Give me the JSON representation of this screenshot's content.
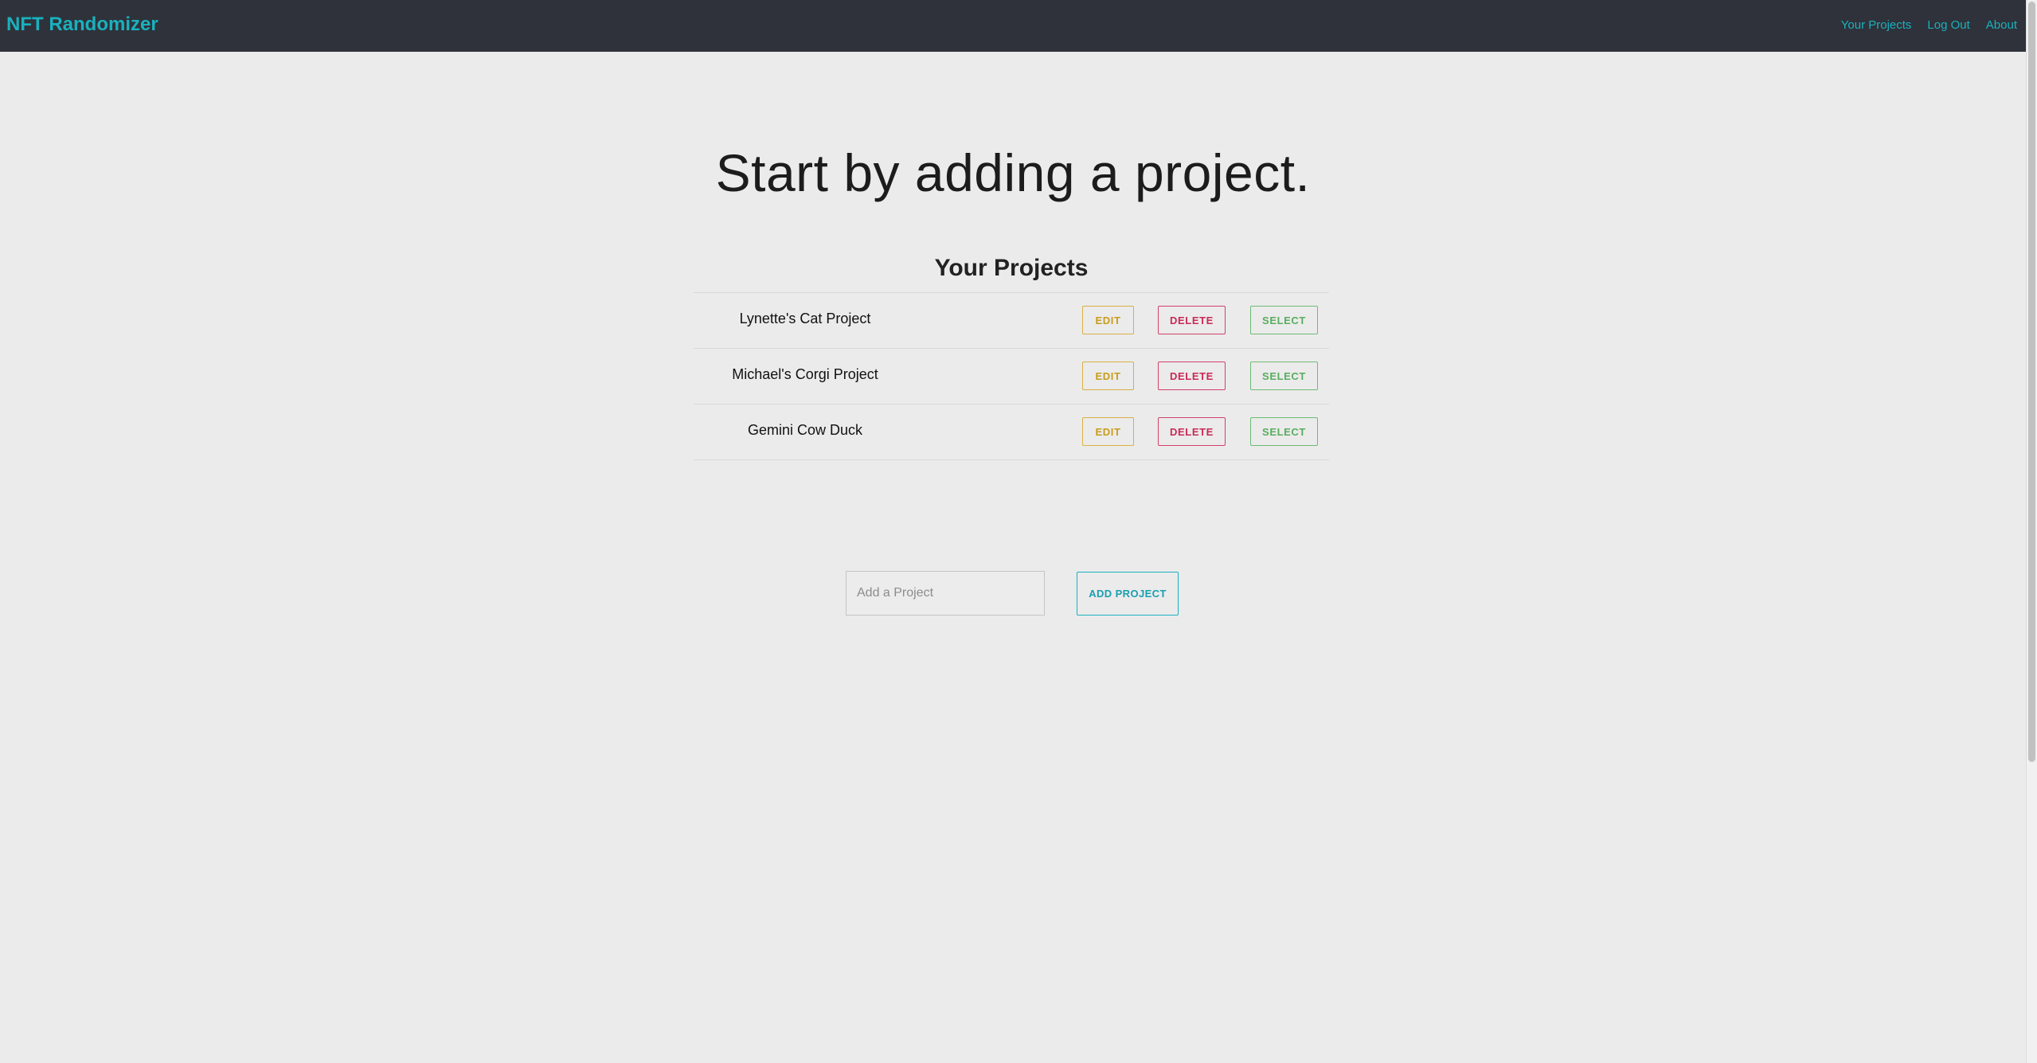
{
  "navbar": {
    "brand": "NFT Randomizer",
    "links": [
      "Your Projects",
      "Log Out",
      "About"
    ]
  },
  "hero": {
    "title": "Start by adding a project."
  },
  "projects": {
    "title": "Your Projects",
    "items": [
      {
        "name": "Lynette's Cat Project",
        "edit": "EDIT",
        "delete": "DELETE",
        "select": "SELECT"
      },
      {
        "name": "Michael's Corgi Project",
        "edit": "EDIT",
        "delete": "DELETE",
        "select": "SELECT"
      },
      {
        "name": "Gemini Cow Duck",
        "edit": "EDIT",
        "delete": "DELETE",
        "select": "SELECT"
      }
    ]
  },
  "add_form": {
    "placeholder": "Add a Project",
    "value": "",
    "button_label": "ADD PROJECT"
  },
  "colors": {
    "navbar_bg": "#2f323a",
    "accent": "#1ab1be",
    "page_bg": "#ebebeb",
    "edit": "#c89d1c",
    "delete": "#c92a55",
    "select": "#59ad5e"
  }
}
